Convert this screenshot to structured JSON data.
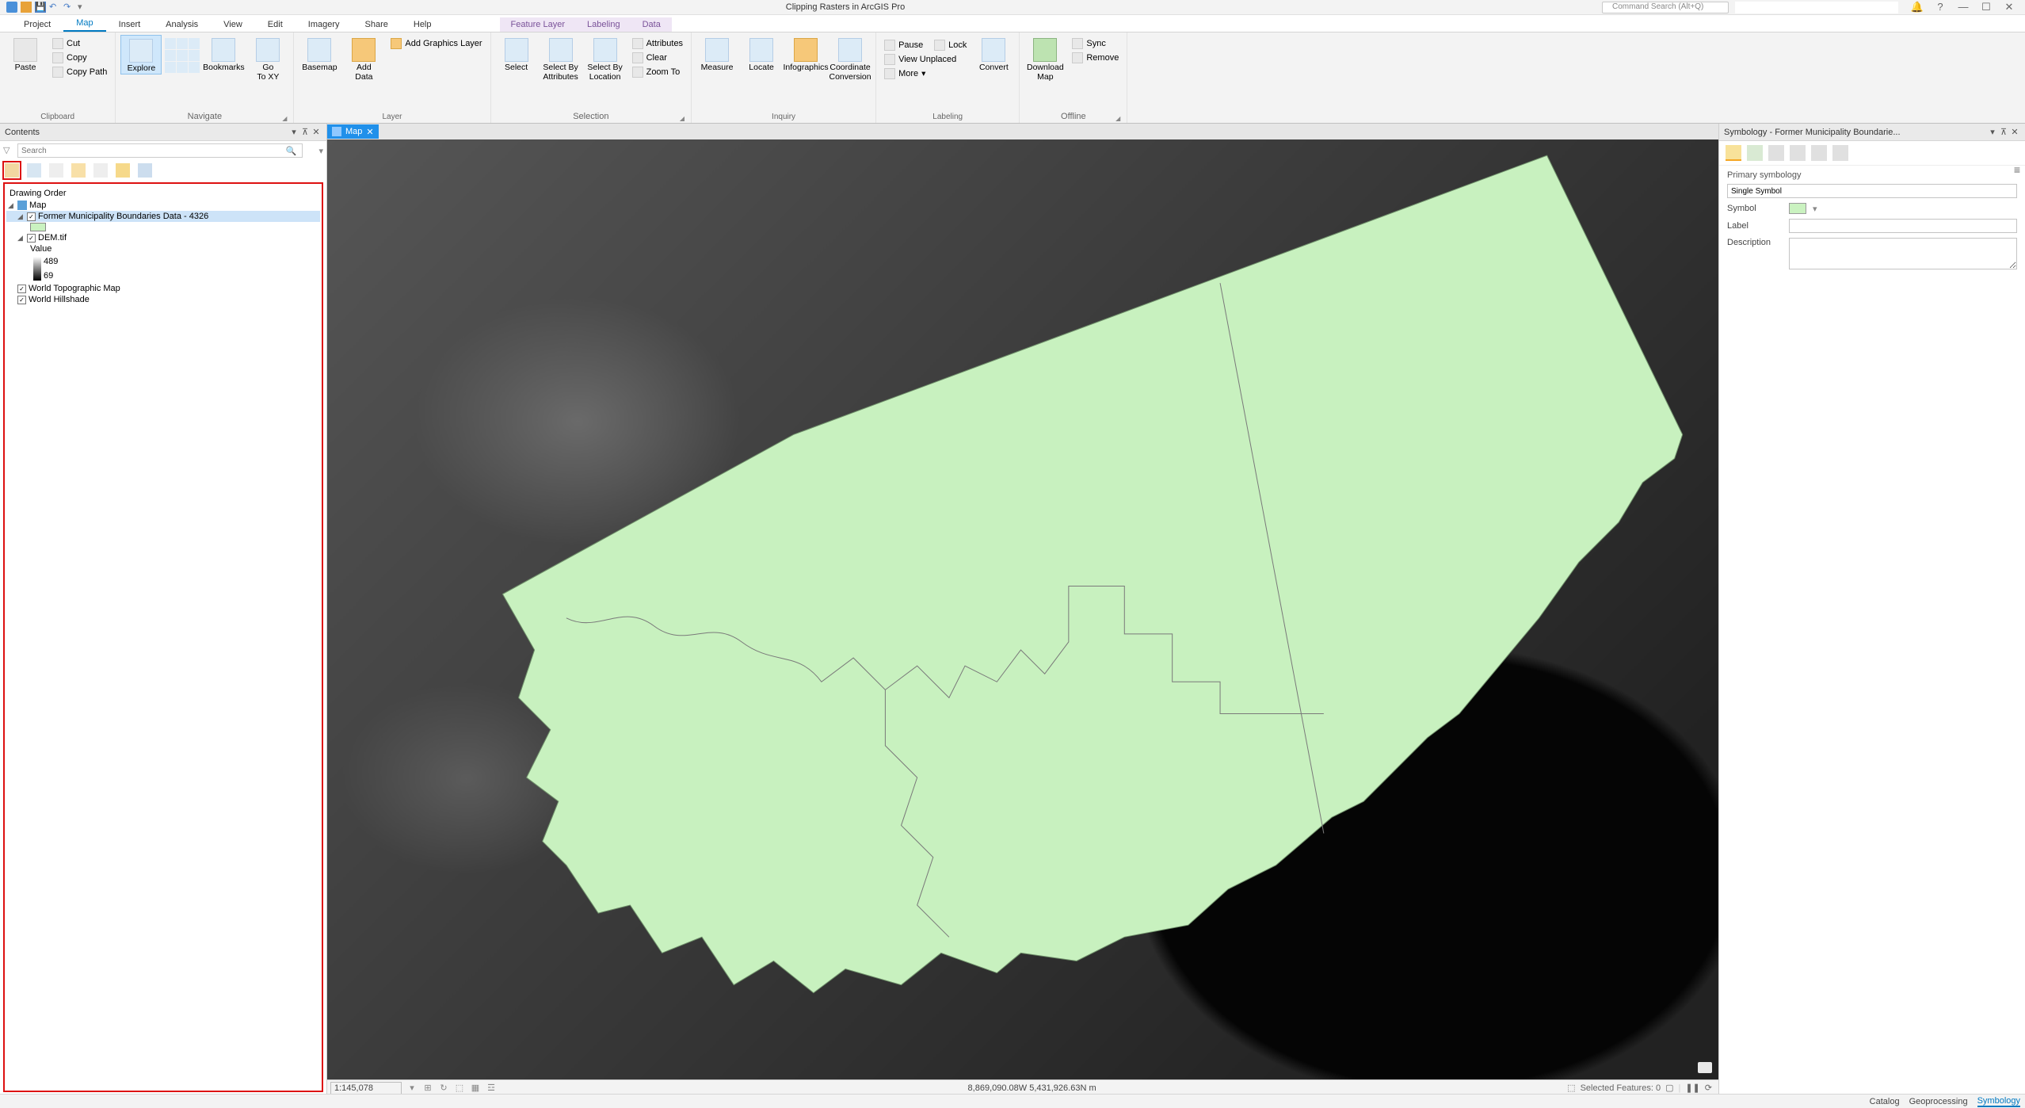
{
  "app": {
    "title": "Clipping Rasters in ArcGIS Pro",
    "command_search_placeholder": "Command Search (Alt+Q)"
  },
  "ribbon": {
    "tabs": [
      "Project",
      "Map",
      "Insert",
      "Analysis",
      "View",
      "Edit",
      "Imagery",
      "Share",
      "Help"
    ],
    "active_tab": "Map",
    "context_tabs": [
      "Feature Layer",
      "Labeling",
      "Data"
    ],
    "groups": {
      "clipboard": {
        "label": "Clipboard",
        "paste": "Paste",
        "cut": "Cut",
        "copy": "Copy",
        "copy_path": "Copy Path"
      },
      "navigate": {
        "label": "Navigate",
        "explore": "Explore",
        "bookmarks": "Bookmarks",
        "goto": "Go\nTo XY",
        "nav_btns": [
          "Full Extent",
          "Prev Extent",
          "Next Extent",
          "Fixed Zoom In",
          "Fixed Zoom Out",
          "Zoom To Selection"
        ]
      },
      "layer": {
        "label": "Layer",
        "basemap": "Basemap",
        "add_data": "Add\nData",
        "add_graphics": "Add Graphics Layer"
      },
      "selection": {
        "label": "Selection",
        "select": "Select",
        "select_by_attr": "Select By\nAttributes",
        "select_by_loc": "Select By\nLocation",
        "attributes": "Attributes",
        "clear": "Clear",
        "zoom_to": "Zoom To"
      },
      "inquiry": {
        "label": "Inquiry",
        "measure": "Measure",
        "locate": "Locate",
        "infographics": "Infographics",
        "coord_conv": "Coordinate\nConversion"
      },
      "labeling": {
        "label": "Labeling",
        "pause": "Pause",
        "lock": "Lock",
        "view_unplaced": "View Unplaced",
        "more": "More",
        "convert": "Convert"
      },
      "offline": {
        "label": "Offline",
        "download": "Download\nMap",
        "sync": "Sync",
        "remove": "Remove"
      }
    }
  },
  "contents": {
    "title": "Contents",
    "search_placeholder": "Search",
    "heading": "Drawing Order",
    "map_label": "Map",
    "layers": {
      "boundaries": {
        "name": "Former Municipality Boundaries Data - 4326",
        "checked": true
      },
      "dem": {
        "name": "DEM.tif",
        "checked": true,
        "value_label": "Value",
        "max": "489",
        "min": "69"
      },
      "topo": {
        "name": "World Topographic Map",
        "checked": true
      },
      "hillshade": {
        "name": "World Hillshade",
        "checked": true
      }
    }
  },
  "map_view": {
    "tab_label": "Map"
  },
  "status": {
    "scale": "1:145,078",
    "coords": "8,869,090.08W 5,431,926.63N m",
    "selected": "Selected Features: 0"
  },
  "symbology": {
    "title": "Symbology - Former Municipality Boundarie...",
    "primary_label": "Primary symbology",
    "primary_value": "Single Symbol",
    "symbol_label": "Symbol",
    "label_label": "Label",
    "label_value": "",
    "description_label": "Description",
    "description_value": ""
  },
  "footer_tabs": {
    "catalog": "Catalog",
    "geoprocessing": "Geoprocessing",
    "symbology": "Symbology",
    "active": "Symbology"
  }
}
